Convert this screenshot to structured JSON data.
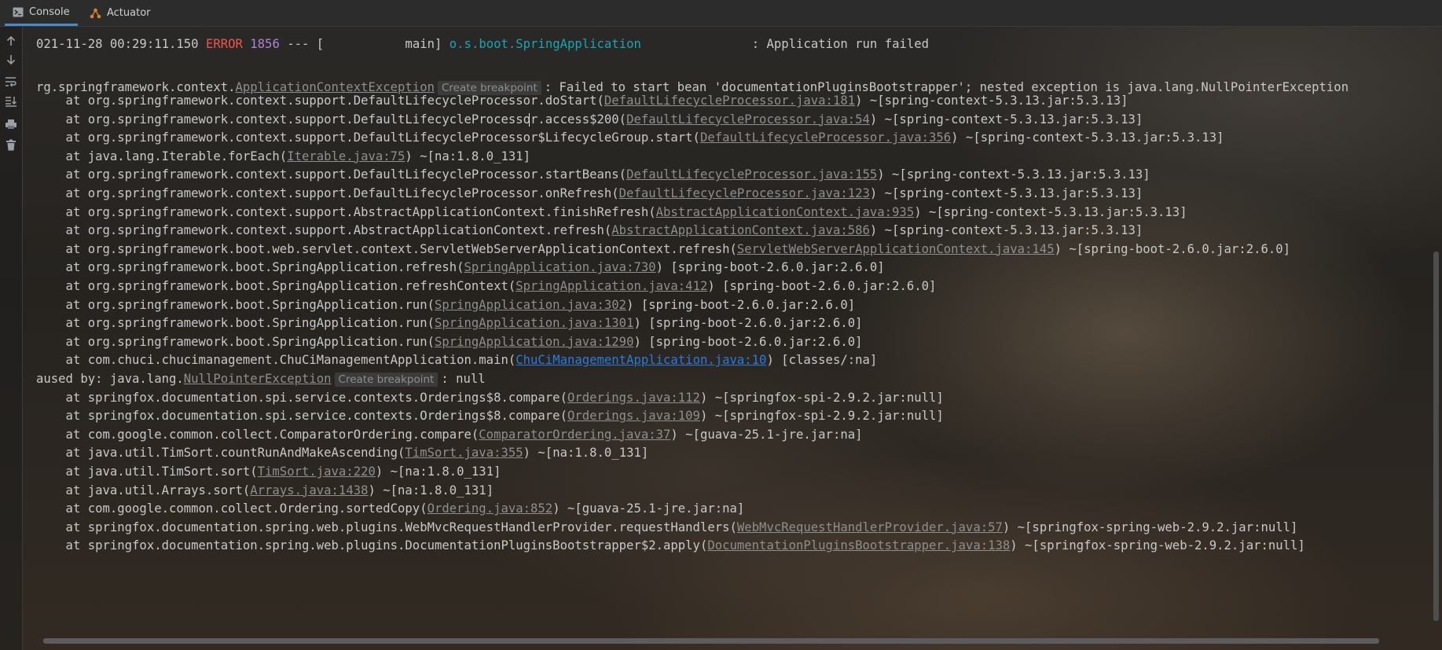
{
  "tabs": [
    {
      "label": "Console",
      "icon": "console-icon"
    },
    {
      "label": "Actuator",
      "icon": "actuator-icon"
    }
  ],
  "toolbar": [
    "up-arrow-icon",
    "down-arrow-icon",
    "soft-wrap-icon",
    "scroll-to-end-icon",
    "print-icon",
    "trash-icon"
  ],
  "header_line": {
    "timestamp": "021-11-28 00:29:11.150",
    "level": "ERROR",
    "pid": "1856",
    "thread": "--- [           main]",
    "logger": "o.s.boot.SpringApplication",
    "message": ": Application run failed"
  },
  "exception1": {
    "prefix": "rg.springframework.context.",
    "exception": "ApplicationContextException",
    "breakpoint": "Create breakpoint",
    "message": ": Failed to start bean 'documentationPluginsBootstrapper'; nested exception is java.lang.NullPointerException"
  },
  "frames1": [
    {
      "pre": "    at org.springframework.context.support.DefaultLifecycleProcessor.doStart(",
      "link": "DefaultLifecycleProcessor.java:181",
      "post": ") ~[spring-context-5.3.13.jar:5.3.13]"
    },
    {
      "pre": "    at org.springframework.context.support.DefaultLifecycleProcessor.access$200(",
      "link": "DefaultLifecycleProcessor.java:54",
      "post": ") ~[spring-context-5.3.13.jar:5.3.13]"
    },
    {
      "pre": "    at org.springframework.context.support.DefaultLifecycleProcessor$LifecycleGroup.start(",
      "link": "DefaultLifecycleProcessor.java:356",
      "post": ") ~[spring-context-5.3.13.jar:5.3.13]"
    },
    {
      "pre": "    at java.lang.Iterable.forEach(",
      "link": "Iterable.java:75",
      "post": ") ~[na:1.8.0_131]"
    },
    {
      "pre": "    at org.springframework.context.support.DefaultLifecycleProcessor.startBeans(",
      "link": "DefaultLifecycleProcessor.java:155",
      "post": ") ~[spring-context-5.3.13.jar:5.3.13]"
    },
    {
      "pre": "    at org.springframework.context.support.DefaultLifecycleProcessor.onRefresh(",
      "link": "DefaultLifecycleProcessor.java:123",
      "post": ") ~[spring-context-5.3.13.jar:5.3.13]"
    },
    {
      "pre": "    at org.springframework.context.support.AbstractApplicationContext.finishRefresh(",
      "link": "AbstractApplicationContext.java:935",
      "post": ") ~[spring-context-5.3.13.jar:5.3.13]"
    },
    {
      "pre": "    at org.springframework.context.support.AbstractApplicationContext.refresh(",
      "link": "AbstractApplicationContext.java:586",
      "post": ") ~[spring-context-5.3.13.jar:5.3.13]"
    },
    {
      "pre": "    at org.springframework.boot.web.servlet.context.ServletWebServerApplicationContext.refresh(",
      "link": "ServletWebServerApplicationContext.java:145",
      "post": ") ~[spring-boot-2.6.0.jar:2.6.0]"
    },
    {
      "pre": "    at org.springframework.boot.SpringApplication.refresh(",
      "link": "SpringApplication.java:730",
      "post": ") [spring-boot-2.6.0.jar:2.6.0]"
    },
    {
      "pre": "    at org.springframework.boot.SpringApplication.refreshContext(",
      "link": "SpringApplication.java:412",
      "post": ") [spring-boot-2.6.0.jar:2.6.0]"
    },
    {
      "pre": "    at org.springframework.boot.SpringApplication.run(",
      "link": "SpringApplication.java:302",
      "post": ") [spring-boot-2.6.0.jar:2.6.0]"
    },
    {
      "pre": "    at org.springframework.boot.SpringApplication.run(",
      "link": "SpringApplication.java:1301",
      "post": ") [spring-boot-2.6.0.jar:2.6.0]"
    },
    {
      "pre": "    at org.springframework.boot.SpringApplication.run(",
      "link": "SpringApplication.java:1290",
      "post": ") [spring-boot-2.6.0.jar:2.6.0]"
    },
    {
      "pre": "    at com.chuci.chucimanagement.ChuCiManagementApplication.main(",
      "link": "ChuCiManagementApplication.java:10",
      "post": ") [classes/:na]",
      "blue": true
    }
  ],
  "exception2": {
    "prefix": "aused by: java.lang.",
    "exception": "NullPointerException",
    "breakpoint": "Create breakpoint",
    "message": ": null"
  },
  "frames2": [
    {
      "pre": "    at springfox.documentation.spi.service.contexts.Orderings$8.compare(",
      "link": "Orderings.java:112",
      "post": ") ~[springfox-spi-2.9.2.jar:null]"
    },
    {
      "pre": "    at springfox.documentation.spi.service.contexts.Orderings$8.compare(",
      "link": "Orderings.java:109",
      "post": ") ~[springfox-spi-2.9.2.jar:null]"
    },
    {
      "pre": "    at com.google.common.collect.ComparatorOrdering.compare(",
      "link": "ComparatorOrdering.java:37",
      "post": ") ~[guava-25.1-jre.jar:na]"
    },
    {
      "pre": "    at java.util.TimSort.countRunAndMakeAscending(",
      "link": "TimSort.java:355",
      "post": ") ~[na:1.8.0_131]"
    },
    {
      "pre": "    at java.util.TimSort.sort(",
      "link": "TimSort.java:220",
      "post": ") ~[na:1.8.0_131]"
    },
    {
      "pre": "    at java.util.Arrays.sort(",
      "link": "Arrays.java:1438",
      "post": ") ~[na:1.8.0_131]"
    },
    {
      "pre": "    at com.google.common.collect.Ordering.sortedCopy(",
      "link": "Ordering.java:852",
      "post": ") ~[guava-25.1-jre.jar:na]"
    },
    {
      "pre": "    at springfox.documentation.spring.web.plugins.WebMvcRequestHandlerProvider.requestHandlers(",
      "link": "WebMvcRequestHandlerProvider.java:57",
      "post": ") ~[springfox-spring-web-2.9.2.jar:null]"
    },
    {
      "pre": "    at springfox.documentation.spring.web.plugins.DocumentationPluginsBootstrapper$2.apply(",
      "link": "DocumentationPluginsBootstrapper.java:138",
      "post": ") ~[springfox-spring-web-2.9.2.jar:null]"
    }
  ],
  "colors": {
    "error": "#f0524f",
    "pid": "#b180d7",
    "logger": "#16a6b6",
    "link": "#8e8e8e",
    "user_link": "#287bde",
    "accent_tab": "#4a88c7"
  }
}
